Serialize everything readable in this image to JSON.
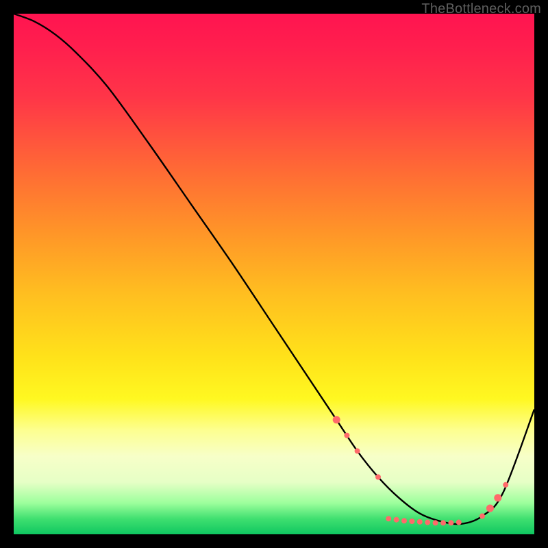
{
  "watermark": "TheBottleneck.com",
  "chart_data": {
    "type": "line",
    "title": "",
    "xlabel": "",
    "ylabel": "",
    "xlim": [
      0,
      100
    ],
    "ylim": [
      0,
      100
    ],
    "grid": false,
    "legend": false,
    "series": [
      {
        "name": "curve",
        "x": [
          0,
          4,
          8,
          12,
          18,
          26,
          34,
          42,
          50,
          58,
          62,
          66,
          70,
          74,
          78,
          82,
          86,
          90,
          94,
          100
        ],
        "y": [
          100,
          98.5,
          96,
          92.5,
          86,
          75,
          63.5,
          52,
          40,
          28,
          22,
          16,
          11,
          7,
          4,
          2.5,
          2,
          3.5,
          8,
          24
        ]
      }
    ],
    "markers": {
      "name": "highlight-points",
      "color": "#ff6a6a",
      "radius_small": 4,
      "radius_large": 5.5,
      "points": [
        {
          "x": 62,
          "y": 22,
          "r": "large"
        },
        {
          "x": 64,
          "y": 19,
          "r": "small"
        },
        {
          "x": 66,
          "y": 16,
          "r": "small"
        },
        {
          "x": 70,
          "y": 11,
          "r": "small"
        },
        {
          "x": 72,
          "y": 3.0,
          "r": "small"
        },
        {
          "x": 73.5,
          "y": 2.8,
          "r": "small"
        },
        {
          "x": 75,
          "y": 2.6,
          "r": "small"
        },
        {
          "x": 76.5,
          "y": 2.5,
          "r": "small"
        },
        {
          "x": 78,
          "y": 2.4,
          "r": "small"
        },
        {
          "x": 79.5,
          "y": 2.3,
          "r": "small"
        },
        {
          "x": 81,
          "y": 2.2,
          "r": "small"
        },
        {
          "x": 82.5,
          "y": 2.2,
          "r": "small"
        },
        {
          "x": 84,
          "y": 2.2,
          "r": "small"
        },
        {
          "x": 85.5,
          "y": 2.3,
          "r": "small"
        },
        {
          "x": 90,
          "y": 3.5,
          "r": "small"
        },
        {
          "x": 91.5,
          "y": 5.0,
          "r": "large"
        },
        {
          "x": 93,
          "y": 7.0,
          "r": "large"
        },
        {
          "x": 94.5,
          "y": 9.5,
          "r": "small"
        }
      ]
    }
  }
}
